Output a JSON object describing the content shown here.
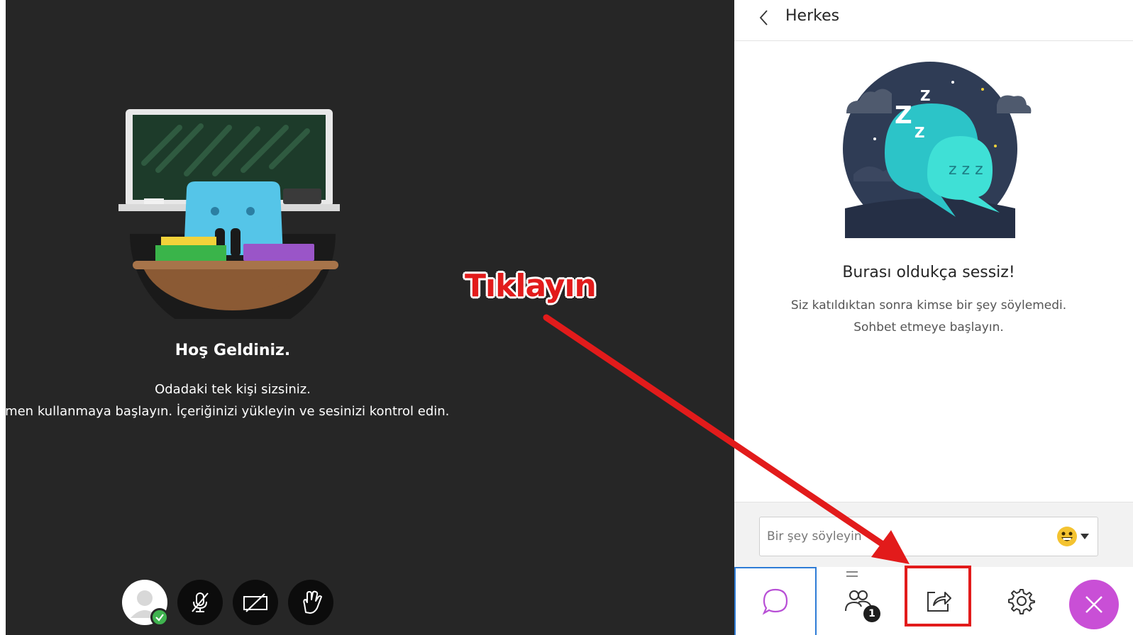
{
  "stage": {
    "welcome_title": "Hoş Geldiniz.",
    "welcome_line1": "Odadaki tek kişi sizsiniz.",
    "welcome_line2": "emen kullanmaya başlayın. İçeriğinizi yükleyin ve sesinizi kontrol edin.",
    "controls": [
      {
        "name": "avatar",
        "icon": "user-avatar-icon",
        "status": "check-icon"
      },
      {
        "name": "mute",
        "icon": "microphone-off-icon"
      },
      {
        "name": "camera",
        "icon": "camera-off-icon"
      },
      {
        "name": "raise-hand",
        "icon": "hand-icon"
      }
    ]
  },
  "annotation": {
    "text": "Tıklayın",
    "color": "#e21b1b"
  },
  "panel": {
    "title": "Herkes",
    "empty_title": "Burası oldukça sessiz!",
    "empty_line1": "Siz katıldıktan sonra kimse bir şey söylemedi.",
    "empty_line2": "Sohbet etmeye başlayın.",
    "composer": {
      "placeholder": "Bir şey söyleyin"
    },
    "nav": {
      "chat_icon": "chat-bubble-icon",
      "people_icon": "people-icon",
      "people_badge": "1",
      "share_icon": "share-content-icon",
      "settings_icon": "gear-icon",
      "close_icon": "close-icon"
    },
    "colors": {
      "accent": "#2e7cd6",
      "chat_icon": "#b84fd6",
      "close_bg": "#c94fd6"
    }
  }
}
